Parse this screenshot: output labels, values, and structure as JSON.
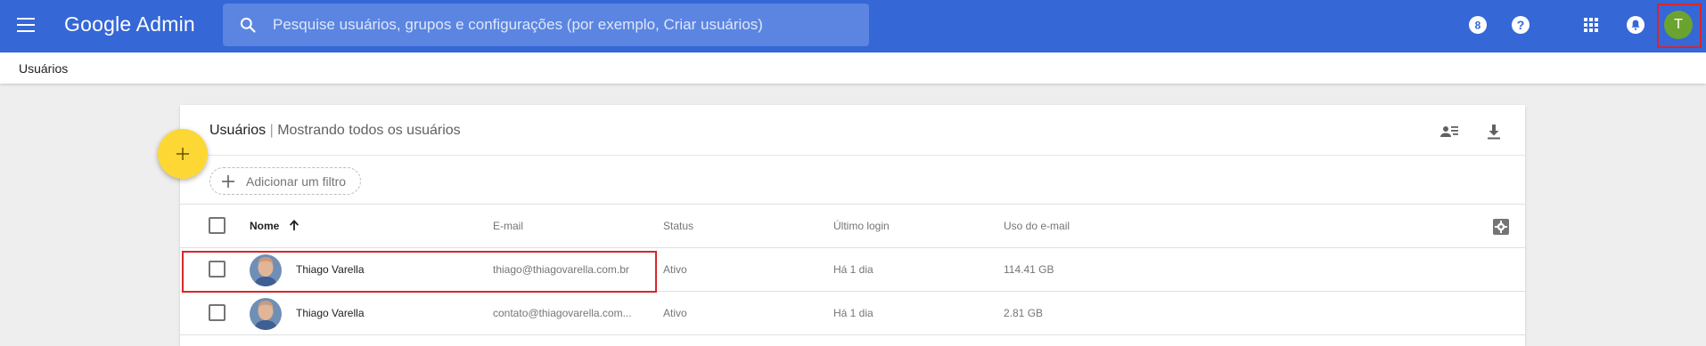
{
  "header": {
    "brand": "Google Admin",
    "search_placeholder": "Pesquise usuários, grupos e configurações (por exemplo, Criar usuários)",
    "avatar_initial": "T",
    "icons": [
      "menu-icon",
      "search-icon",
      "support-8-icon",
      "help-icon",
      "apps-grid-icon",
      "notifications-icon"
    ]
  },
  "breadcrumb": {
    "label": "Usuários"
  },
  "card": {
    "title": "Usuários",
    "separator": "|",
    "subtitle": "Mostrando todos os usuários",
    "filter_label": "Adicionar um filtro"
  },
  "table": {
    "columns": {
      "name": "Nome",
      "email": "E-mail",
      "status": "Status",
      "last_login": "Último login",
      "email_usage": "Uso do e-mail"
    },
    "sort": "ascending",
    "rows": [
      {
        "name": "Thiago Varella",
        "email": "thiago@thiagovarella.com.br",
        "status": "Ativo",
        "last_login": "Há 1 dia",
        "usage": "114.41 GB"
      },
      {
        "name": "Thiago Varella",
        "email": "contato@thiagovarella.com...",
        "status": "Ativo",
        "last_login": "Há 1 dia",
        "usage": "2.81 GB"
      }
    ]
  },
  "colors": {
    "header_blue": "#3567d6",
    "fab_yellow": "#fdd835",
    "highlight_red": "#d8262b",
    "avatar_green": "#6aa42f"
  }
}
